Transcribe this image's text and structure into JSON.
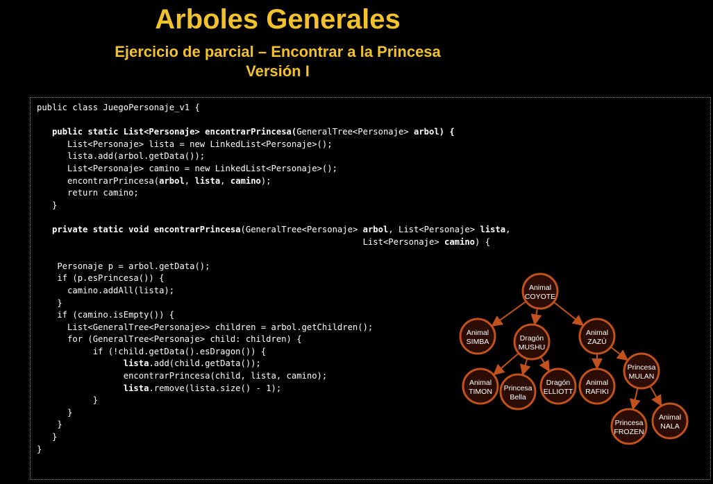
{
  "header": {
    "title": "Arboles Generales",
    "subtitle": "Ejercicio de parcial – Encontrar a la Princesa",
    "version": "Versión I"
  },
  "code": [
    [
      "public class JuegoPersonaje_v1 {"
    ],
    [
      ""
    ],
    [
      "   ",
      "*public static List<Personaje> encontrarPrincesa(",
      "GeneralTree<Personaje> ",
      "*arbol",
      "*) {"
    ],
    [
      "      List<Personaje> lista = new LinkedList<Personaje>();"
    ],
    [
      "      lista.add(arbol.getData());"
    ],
    [
      "      List<Personaje> camino = new LinkedList<Personaje>();"
    ],
    [
      "      encontrarPrincesa(",
      "*arbol",
      ", ",
      "*lista",
      ", ",
      "*camino",
      ");"
    ],
    [
      "      return camino;"
    ],
    [
      "   }"
    ],
    [
      ""
    ],
    [
      "   ",
      "*private static void encontrarPrincesa",
      "(GeneralTree<Personaje> ",
      "*arbol",
      ", List<Personaje> ",
      "*lista",
      ","
    ],
    [
      "                                                                List<Personaje> ",
      "*camino",
      ") {"
    ],
    [
      ""
    ],
    [
      "    Personaje p = arbol.getData();"
    ],
    [
      "    if (p.esPrincesa()) {"
    ],
    [
      "      camino.addAll(lista);"
    ],
    [
      "    }"
    ],
    [
      "    if (camino.isEmpty()) {"
    ],
    [
      "      List<GeneralTree<Personaje>> children = arbol.getChildren();"
    ],
    [
      "      for (GeneralTree<Personaje> child: children) {"
    ],
    [
      "           if (!child.getData().esDragon()) {"
    ],
    [
      "                 ",
      "*lista",
      ".add(child.getData());"
    ],
    [
      "                 encontrarPrincesa(child, lista, camino);"
    ],
    [
      "                 ",
      "*lista",
      ".remove(lista.size() - 1);"
    ],
    [
      "           }"
    ],
    [
      "      }"
    ],
    [
      "    }"
    ],
    [
      "   }"
    ],
    [
      "}"
    ]
  ],
  "tree": {
    "nodes": [
      {
        "id": "coyote",
        "type": "Animal",
        "name": "COYOTE"
      },
      {
        "id": "simba",
        "type": "Animal",
        "name": "SIMBA"
      },
      {
        "id": "mushu",
        "type": "Dragón",
        "name": "MUSHU"
      },
      {
        "id": "zazu",
        "type": "Animal",
        "name": "ZAZÚ"
      },
      {
        "id": "timon",
        "type": "Animal",
        "name": "TIMON"
      },
      {
        "id": "bella",
        "type": "Princesa",
        "name": "Bella"
      },
      {
        "id": "elliott",
        "type": "Dragón",
        "name": "ELLIOTT"
      },
      {
        "id": "rafiki",
        "type": "Animal",
        "name": "RAFIKI"
      },
      {
        "id": "mulan",
        "type": "Princesa",
        "name": "MULAN"
      },
      {
        "id": "frozen",
        "type": "Princesa",
        "name": "FROZEN"
      },
      {
        "id": "nala",
        "type": "Animal",
        "name": "NALA"
      }
    ],
    "edges": [
      [
        "coyote",
        "simba"
      ],
      [
        "coyote",
        "mushu"
      ],
      [
        "coyote",
        "zazu"
      ],
      [
        "mushu",
        "timon"
      ],
      [
        "mushu",
        "bella"
      ],
      [
        "mushu",
        "elliott"
      ],
      [
        "zazu",
        "rafiki"
      ],
      [
        "zazu",
        "mulan"
      ],
      [
        "mulan",
        "frozen"
      ],
      [
        "mulan",
        "nala"
      ]
    ],
    "colors": {
      "edge": "#c2521d",
      "fill": "#2b0d05",
      "text": "#ffffff"
    }
  },
  "colors": {
    "title": "#f2c22c",
    "background": "#000000",
    "code": "#ffffff"
  }
}
